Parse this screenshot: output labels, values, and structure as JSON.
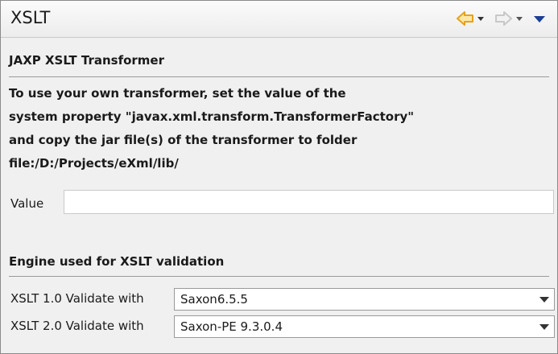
{
  "view": {
    "title": "XSLT"
  },
  "toolbar": {
    "icons": [
      "back-arrow-icon",
      "back-dropdown-icon",
      "forward-arrow-icon",
      "forward-dropdown-icon",
      "view-menu-icon"
    ],
    "accent_color": "#e6a21a",
    "disabled_color": "#c8c8c8",
    "menu_color": "#1c3f95"
  },
  "jaxp": {
    "heading": "JAXP XSLT Transformer",
    "description_lines": [
      "To use your own transformer, set the value of the",
      "system property \"javax.xml.transform.TransformerFactory\"",
      "and copy the jar file(s) of the transformer to folder",
      "file:/D:/Projects/eXml/lib/"
    ],
    "value_label": "Value",
    "value": ""
  },
  "engine": {
    "heading": "Engine used for XSLT validation",
    "rows": [
      {
        "label": "XSLT 1.0 Validate with",
        "selected": "Saxon6.5.5"
      },
      {
        "label": "XSLT 2.0 Validate with",
        "selected": "Saxon-PE 9.3.0.4"
      }
    ]
  }
}
